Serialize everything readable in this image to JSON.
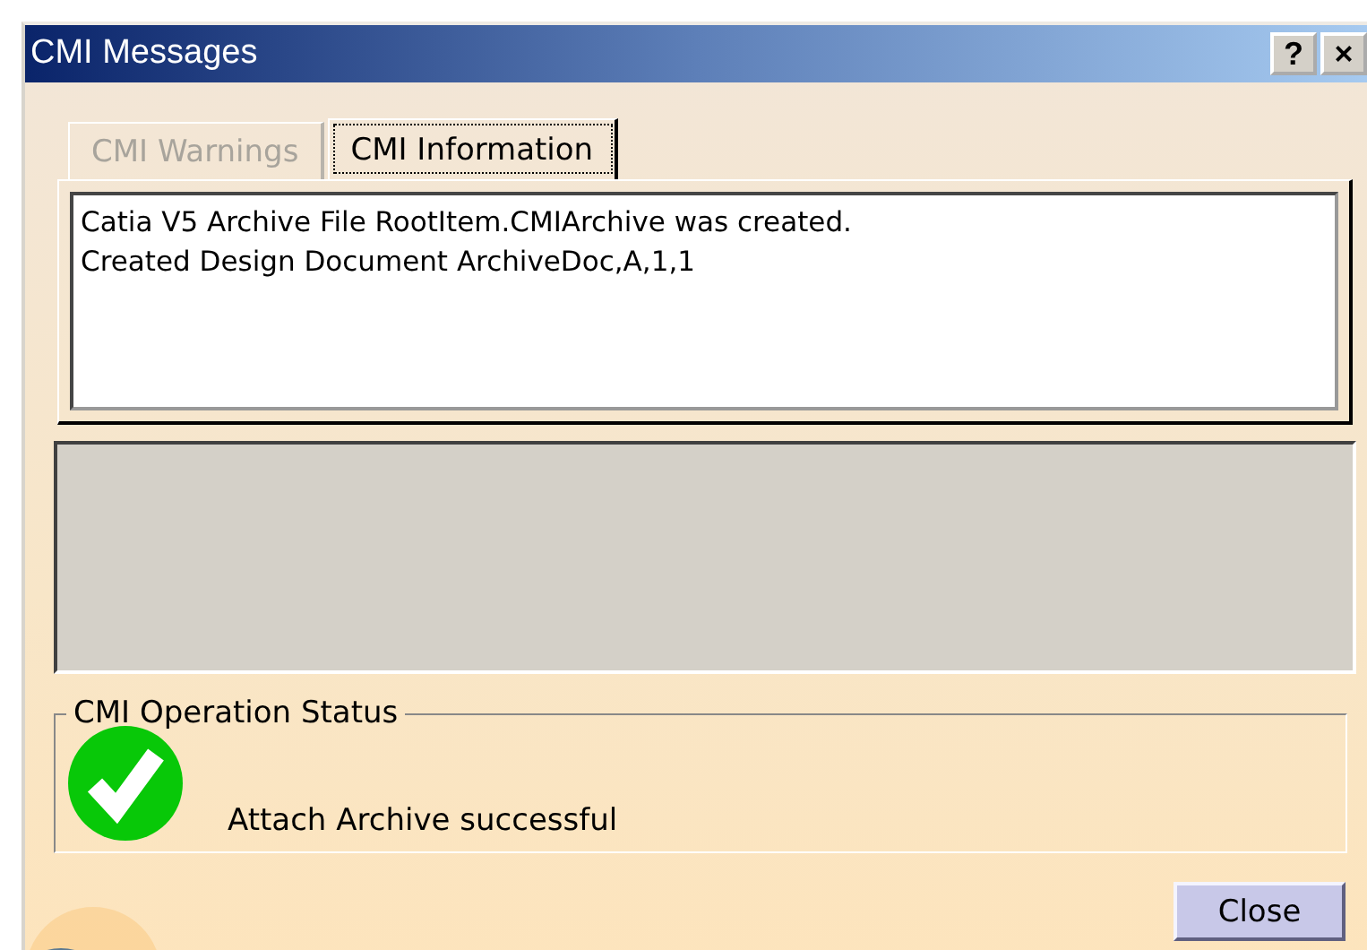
{
  "window": {
    "title": "CMI Messages",
    "title_buttons": [
      "?",
      "×"
    ]
  },
  "tabs": [
    {
      "label": "CMI Warnings",
      "selected": false,
      "disabled": true
    },
    {
      "label": "CMI Information",
      "selected": true,
      "disabled": false
    }
  ],
  "messages": [
    "Catia V5 Archive File RootItem.CMIArchive was created.",
    "Created Design Document ArchiveDoc,A,1,1"
  ],
  "status": {
    "legend": "CMI Operation Status",
    "kind": "success",
    "text": "Attach Archive successful"
  },
  "buttons": [
    "Close"
  ]
}
